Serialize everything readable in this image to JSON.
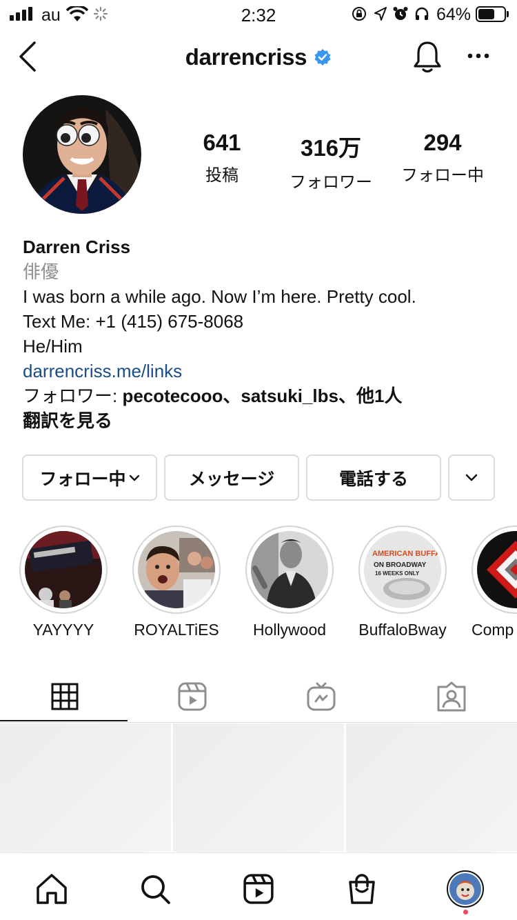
{
  "status": {
    "carrier": "au",
    "time": "2:32",
    "battery": "64%"
  },
  "header": {
    "username": "darrencriss"
  },
  "stats": [
    {
      "num": "641",
      "label": "投稿"
    },
    {
      "num": "316万",
      "label": "フォロワー"
    },
    {
      "num": "294",
      "label": "フォロー中"
    }
  ],
  "bio": {
    "name": "Darren Criss",
    "category": "俳優",
    "line1": "I was born a while ago. Now I’m here. Pretty cool.",
    "line2": "Text Me: +1 (415) 675-8068",
    "line3": "He/Him",
    "link": "darrencriss.me/links",
    "followers_prefix": "フォロワー: ",
    "followers_names": "pecotecooo、satsuki_lbs、他1人",
    "translate": "翻訳を見る"
  },
  "buttons": {
    "following": "フォロー中",
    "message": "メッセージ",
    "call": "電話する"
  },
  "highlights": [
    {
      "label": "YAYYYY"
    },
    {
      "label": "ROYALTiES"
    },
    {
      "label": "Hollywood"
    },
    {
      "label": "BuffaloBway"
    },
    {
      "label": "Comp"
    }
  ],
  "highlight_art": {
    "buffalo_title": "AMERICAN BUFFALO",
    "buffalo_sub": "ON BROADWAY",
    "buffalo_weeks": "16 WEEKS ONLY"
  },
  "colors": {
    "verified": "#3897f0",
    "link": "#1a4b8a",
    "notification_dot": "#ed4956"
  }
}
